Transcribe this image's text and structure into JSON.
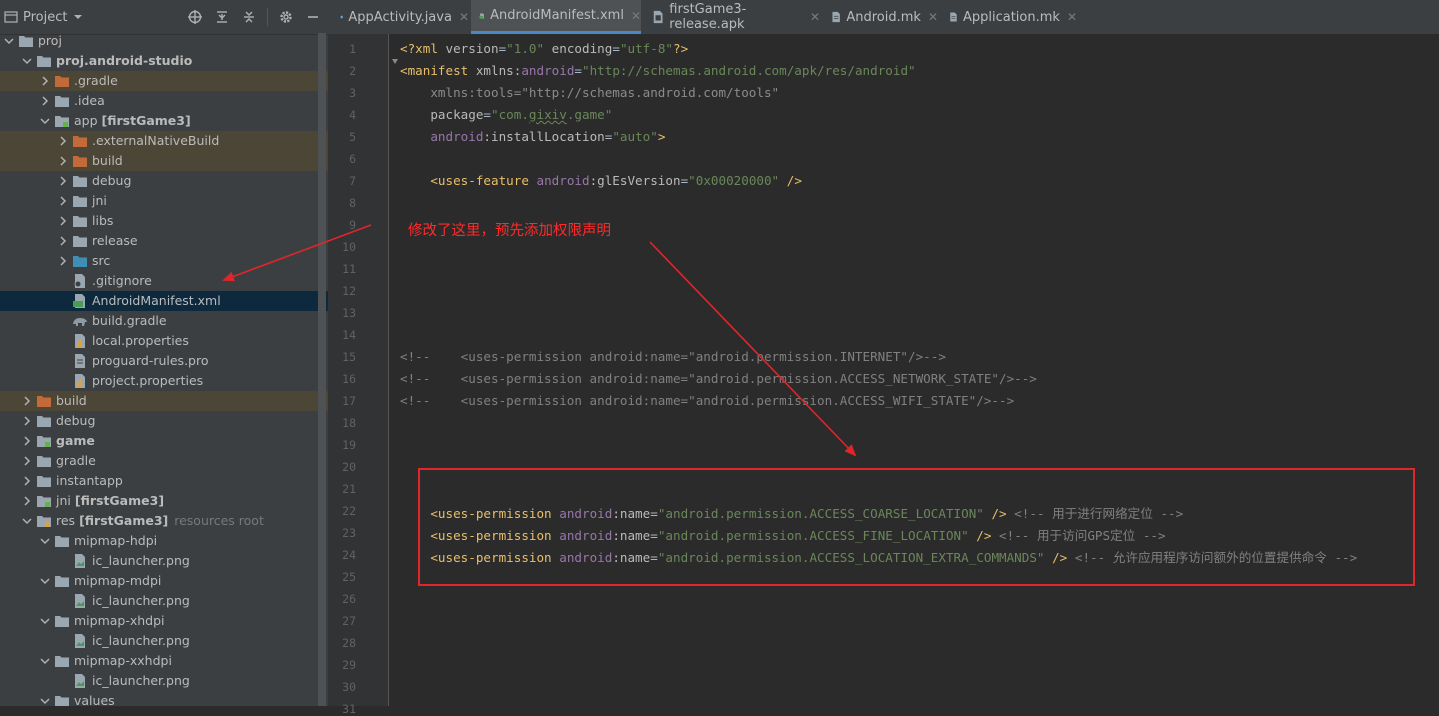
{
  "project_panel": {
    "title": "Project",
    "tree": [
      {
        "label": "proj",
        "kind": "folder-gray",
        "depth": 0,
        "expanded": true
      },
      {
        "label": "proj.android-studio",
        "kind": "folder-gray",
        "depth": 1,
        "expanded": true,
        "bold": true
      },
      {
        "label": ".gradle",
        "kind": "folder-orange",
        "depth": 2,
        "expanded": false,
        "highlight": true
      },
      {
        "label": ".idea",
        "kind": "folder-gray",
        "depth": 2,
        "expanded": false
      },
      {
        "label": "app",
        "label_bold": "[firstGame3]",
        "kind": "folder-module",
        "depth": 2,
        "expanded": true
      },
      {
        "label": ".externalNativeBuild",
        "kind": "folder-orange",
        "depth": 3,
        "expanded": false,
        "highlight": true
      },
      {
        "label": "build",
        "kind": "folder-orange",
        "depth": 3,
        "expanded": false,
        "highlight": true
      },
      {
        "label": "debug",
        "kind": "folder-gray",
        "depth": 3,
        "expanded": false
      },
      {
        "label": "jni",
        "kind": "folder-gray",
        "depth": 3,
        "expanded": false
      },
      {
        "label": "libs",
        "kind": "folder-gray",
        "depth": 3,
        "expanded": false
      },
      {
        "label": "release",
        "kind": "folder-gray",
        "depth": 3,
        "expanded": false
      },
      {
        "label": "src",
        "kind": "folder-blue",
        "depth": 3,
        "expanded": false
      },
      {
        "label": ".gitignore",
        "kind": "file-gitignore",
        "depth": 3
      },
      {
        "label": "AndroidManifest.xml",
        "kind": "file-manifest",
        "depth": 3,
        "selected": true
      },
      {
        "label": "build.gradle",
        "kind": "file-gradle",
        "depth": 3
      },
      {
        "label": "local.properties",
        "kind": "file-props",
        "depth": 3
      },
      {
        "label": "proguard-rules.pro",
        "kind": "file-text",
        "depth": 3
      },
      {
        "label": "project.properties",
        "kind": "file-props",
        "depth": 3
      },
      {
        "label": "build",
        "kind": "folder-orange",
        "depth": 1,
        "expanded": false,
        "highlight": true
      },
      {
        "label": "debug",
        "kind": "folder-gray",
        "depth": 1,
        "expanded": false
      },
      {
        "label": "game",
        "kind": "folder-module",
        "depth": 1,
        "expanded": false,
        "bold": true
      },
      {
        "label": "gradle",
        "kind": "folder-gray",
        "depth": 1,
        "expanded": false
      },
      {
        "label": "instantapp",
        "kind": "folder-gray",
        "depth": 1,
        "expanded": false
      },
      {
        "label": "jni",
        "label_bold": "[firstGame3]",
        "kind": "folder-module",
        "depth": 1,
        "expanded": false
      },
      {
        "label": "res",
        "label_bold": "[firstGame3]",
        "extra": "resources root",
        "kind": "folder-res",
        "depth": 1,
        "expanded": true
      },
      {
        "label": "mipmap-hdpi",
        "kind": "folder-gray",
        "depth": 2,
        "expanded": true
      },
      {
        "label": "ic_launcher.png",
        "kind": "file-image",
        "depth": 3
      },
      {
        "label": "mipmap-mdpi",
        "kind": "folder-gray",
        "depth": 2,
        "expanded": true
      },
      {
        "label": "ic_launcher.png",
        "kind": "file-image",
        "depth": 3
      },
      {
        "label": "mipmap-xhdpi",
        "kind": "folder-gray",
        "depth": 2,
        "expanded": true
      },
      {
        "label": "ic_launcher.png",
        "kind": "file-image",
        "depth": 3
      },
      {
        "label": "mipmap-xxhdpi",
        "kind": "folder-gray",
        "depth": 2,
        "expanded": true
      },
      {
        "label": "ic_launcher.png",
        "kind": "file-image",
        "depth": 3
      },
      {
        "label": "values",
        "kind": "folder-gray",
        "depth": 2,
        "expanded": true
      }
    ]
  },
  "tabs": [
    {
      "label": "AppActivity.java",
      "icon": "java-class-icon",
      "active": false
    },
    {
      "label": "AndroidManifest.xml",
      "icon": "manifest-file-icon",
      "active": true
    },
    {
      "label": "firstGame3-release.apk",
      "icon": "apk-file-icon",
      "active": false
    },
    {
      "label": "Android.mk",
      "icon": "text-file-icon",
      "active": false
    },
    {
      "label": "Application.mk",
      "icon": "text-file-icon",
      "active": false
    }
  ],
  "editor": {
    "lines": [
      [
        [
          "<?xml ",
          "t"
        ],
        [
          "version",
          "a"
        ],
        [
          "=",
          "p"
        ],
        [
          "\"1.0\"",
          "v"
        ],
        [
          " encoding",
          "a"
        ],
        [
          "=",
          "p"
        ],
        [
          "\"utf-8\"",
          "v"
        ],
        [
          "?>",
          "t"
        ]
      ],
      [
        [
          "<manifest ",
          "t"
        ],
        [
          "xmlns:",
          "a"
        ],
        [
          "android",
          "ns"
        ],
        [
          "=",
          "p"
        ],
        [
          "\"http://schemas.android.com/apk/res/android\"",
          "v"
        ]
      ],
      [
        [
          "    xmlns:tools=\"http://schemas.android.com/tools\"",
          "dim"
        ]
      ],
      [
        [
          "    package",
          "a"
        ],
        [
          "=",
          "p"
        ],
        [
          "\"com.",
          "v"
        ],
        [
          "gixiv",
          "vsq"
        ],
        [
          ".game\"",
          "v"
        ]
      ],
      [
        [
          "    ",
          "p"
        ],
        [
          "android",
          "ns"
        ],
        [
          ":installLocation",
          "a"
        ],
        [
          "=",
          "p"
        ],
        [
          "\"auto\"",
          "v"
        ],
        [
          ">",
          "t"
        ]
      ],
      [],
      [
        [
          "    <uses-feature ",
          "t"
        ],
        [
          "android",
          "ns"
        ],
        [
          ":glEsVersion",
          "a"
        ],
        [
          "=",
          "p"
        ],
        [
          "\"0x00020000\"",
          "v"
        ],
        [
          " />",
          "t"
        ]
      ],
      [],
      [],
      [],
      [],
      [],
      [],
      [],
      [
        [
          "<!--    <uses-permission android:name=\"android.permission.INTERNET\"/>-->",
          "c"
        ]
      ],
      [
        [
          "<!--    <uses-permission android:name=\"android.permission.ACCESS_NETWORK_STATE\"/>-->",
          "c"
        ]
      ],
      [
        [
          "<!--    <uses-permission android:name=\"android.permission.ACCESS_WIFI_STATE\"/>-->",
          "c"
        ]
      ],
      [],
      [],
      [],
      [],
      [
        [
          "    <uses-permission ",
          "t"
        ],
        [
          "android",
          "ns"
        ],
        [
          ":name",
          "a"
        ],
        [
          "=",
          "p"
        ],
        [
          "\"android.permission.ACCESS_COARSE_LOCATION\"",
          "v"
        ],
        [
          " /> ",
          "t"
        ],
        [
          "<!-- 用于进行网络定位 -->",
          "c"
        ]
      ],
      [
        [
          "    <uses-permission ",
          "t"
        ],
        [
          "android",
          "ns"
        ],
        [
          ":name",
          "a"
        ],
        [
          "=",
          "p"
        ],
        [
          "\"android.permission.ACCESS_FINE_LOCATION\"",
          "v"
        ],
        [
          " /> ",
          "t"
        ],
        [
          "<!-- 用于访问GPS定位 -->",
          "c"
        ]
      ],
      [
        [
          "    <uses-permission ",
          "t"
        ],
        [
          "android",
          "ns"
        ],
        [
          ":name",
          "a"
        ],
        [
          "=",
          "p"
        ],
        [
          "\"android.permission.ACCESS_LOCATION_EXTRA_COMMANDS\"",
          "v"
        ],
        [
          " /> ",
          "t"
        ],
        [
          "<!-- 允许应用程序访问额外的位置提供命令 -->",
          "c"
        ]
      ],
      [],
      [],
      [],
      [],
      [],
      [],
      []
    ]
  },
  "annotation": {
    "note_text": "修改了这里，预先添加权限声明",
    "color": "#e0252b"
  },
  "colors": {
    "panel_bg": "#3c3f41",
    "editor_bg": "#2b2b2b",
    "selection": "#0d293e",
    "excluded_highlight": "#4b4636",
    "active_tab_underline": "#4a88c7"
  }
}
